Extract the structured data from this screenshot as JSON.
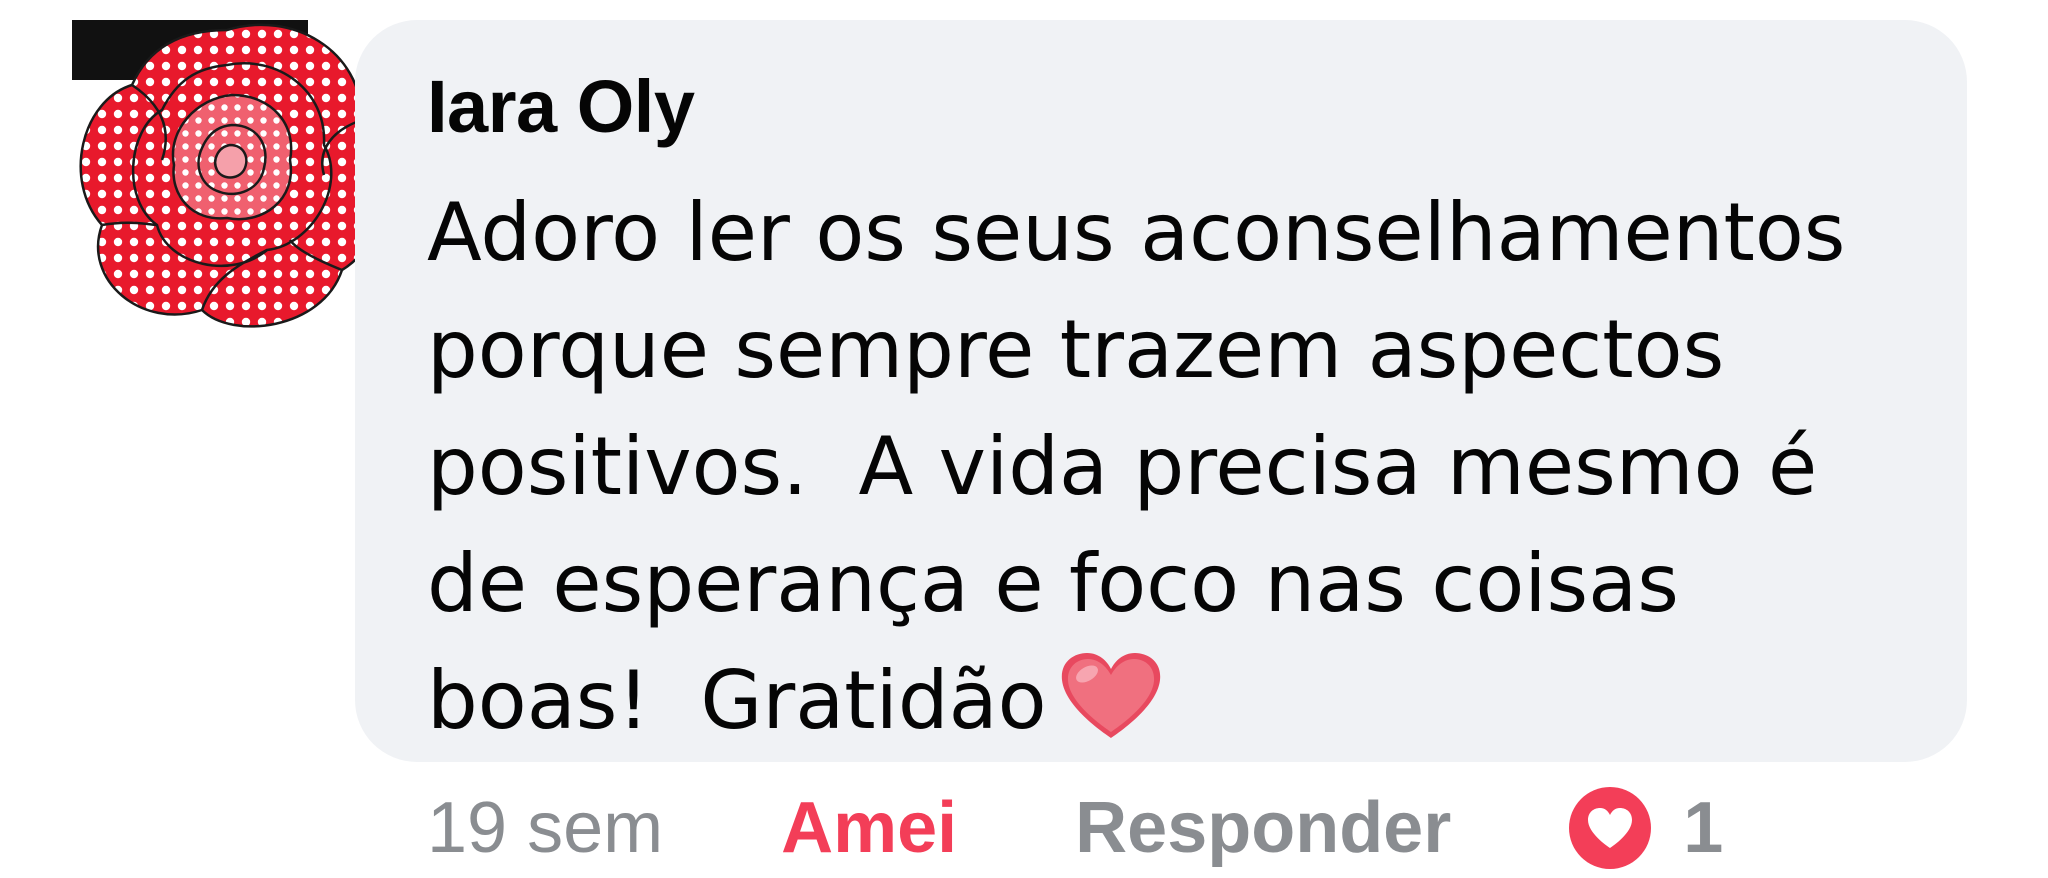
{
  "comment": {
    "author": "Iara Oly",
    "text": "Adoro ler os seus aconselhamentos\nporque sempre trazem aspectos\npositivos.  A vida precisa mesmo é\nde esperança e foco nas coisas\nboas!  Gratidão",
    "emoji": "heart-emoji",
    "avatar_icon": "red-polka-dot-rose-avatar"
  },
  "actions": {
    "timestamp": "19 sem",
    "react_label": "Amei",
    "reply_label": "Responder",
    "reaction_icon": "love-reaction-icon",
    "reaction_count": "1"
  },
  "colors": {
    "bubble_background": "#f0f2f5",
    "love_red": "#f33e58",
    "muted_gray": "#8a8d91",
    "text_primary": "#050505"
  }
}
